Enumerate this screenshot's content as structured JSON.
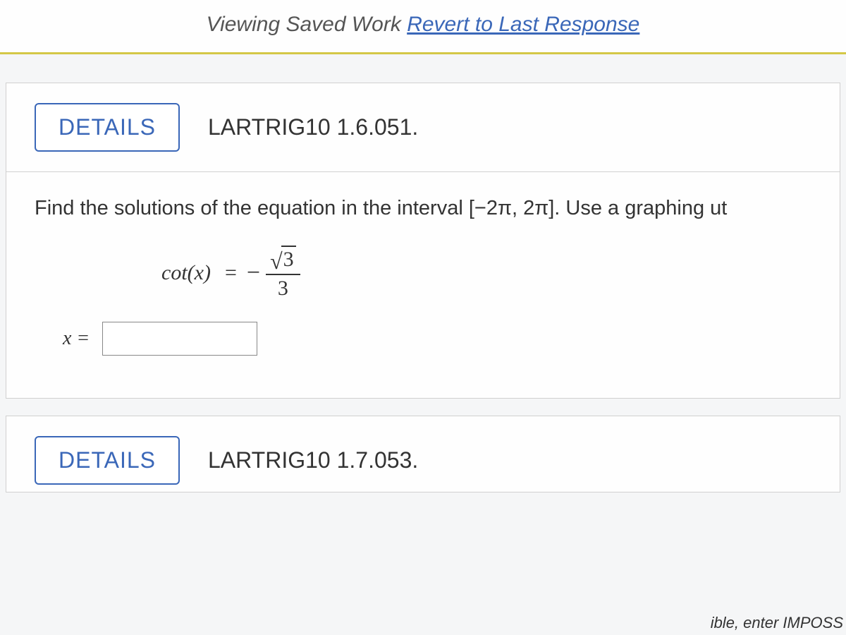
{
  "banner": {
    "prefix": "Viewing Saved Work ",
    "link": "Revert to Last Response"
  },
  "question1": {
    "details_label": "DETAILS",
    "reference": "LARTRIG10 1.6.051.",
    "instruction": "Find the solutions of the equation in the interval [−2π, 2π]. Use a graphing ut",
    "equation": {
      "func": "cot",
      "var": "x",
      "equals": "=",
      "sign": "−",
      "sqrt_val": "3",
      "denom": "3"
    },
    "answer_label": "x =",
    "answer_value": ""
  },
  "question2": {
    "details_label": "DETAILS",
    "reference": "LARTRIG10 1.7.053."
  },
  "hint_fragment": "ible, enter IMPOSS"
}
